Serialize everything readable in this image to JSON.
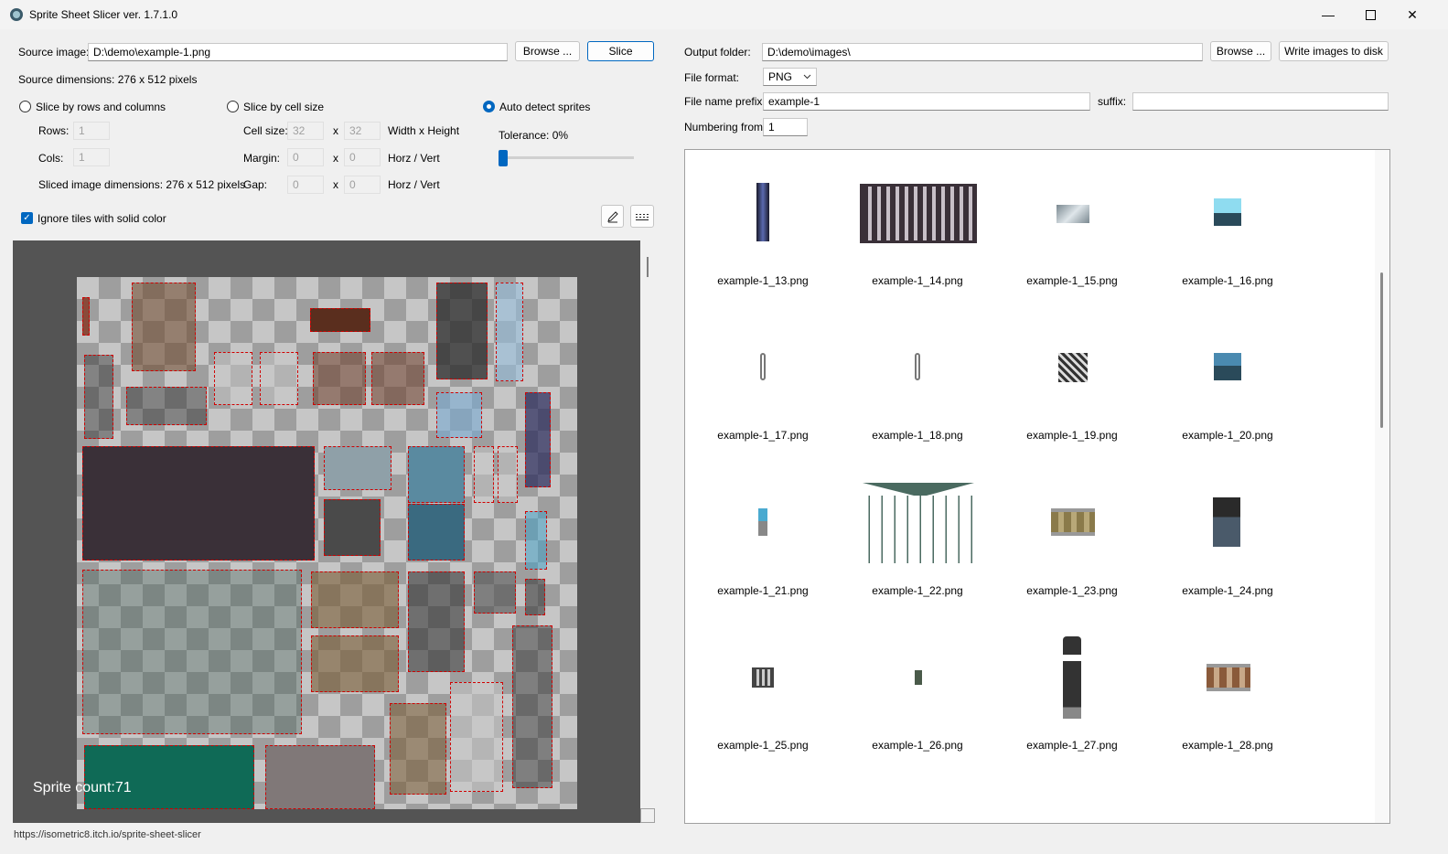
{
  "window": {
    "title": "Sprite Sheet Slicer ver. 1.7.1.0"
  },
  "source": {
    "label": "Source image:",
    "path": "D:\\demo\\example-1.png",
    "browse": "Browse ...",
    "slice": "Slice",
    "dimensions": "Source dimensions:   276 x 512 pixels"
  },
  "modes": {
    "rows_cols": "Slice by rows and columns",
    "cell_size": "Slice by cell size",
    "auto": "Auto detect sprites",
    "selected": "Auto detect sprites"
  },
  "rows_cols": {
    "rows_label": "Rows:",
    "rows": "1",
    "cols_label": "Cols:",
    "cols": "1",
    "sliced_dims": "Sliced image dimensions:   276 x 512 pixels"
  },
  "cell": {
    "cell_label": "Cell size:",
    "cell_w": "32",
    "cell_h": "32",
    "cell_unit": "Width x Height",
    "margin_label": "Margin:",
    "margin_h": "0",
    "margin_v": "0",
    "margin_unit": "Horz / Vert",
    "gap_label": "Gap:",
    "gap_h": "0",
    "gap_v": "0",
    "gap_unit": "Horz / Vert",
    "x": "x"
  },
  "auto": {
    "tolerance_label": "Tolerance:   0%",
    "tolerance": 0
  },
  "ignore_solid": {
    "label": "Ignore tiles with solid color",
    "checked": true
  },
  "preview": {
    "sprite_count": "Sprite count:71"
  },
  "output": {
    "folder_label": "Output folder:",
    "folder": "D:\\demo\\images\\",
    "browse": "Browse ...",
    "write": "Write images to disk",
    "format_label": "File format:",
    "format": "PNG",
    "prefix_label": "File name prefix:",
    "prefix": "example-1",
    "suffix_label": "suffix:",
    "suffix": "",
    "numbering_label": "Numbering from:",
    "numbering": "1"
  },
  "files": [
    {
      "name": "example-1_13.png",
      "icon": "pipe-vertical-icon"
    },
    {
      "name": "example-1_14.png",
      "icon": "fence-icon"
    },
    {
      "name": "example-1_15.png",
      "icon": "glass-panel-icon"
    },
    {
      "name": "example-1_16.png",
      "icon": "computer-icon"
    },
    {
      "name": "example-1_17.png",
      "icon": "chain-icon"
    },
    {
      "name": "example-1_18.png",
      "icon": "chain-icon"
    },
    {
      "name": "example-1_19.png",
      "icon": "grate-icon"
    },
    {
      "name": "example-1_20.png",
      "icon": "computer-icon"
    },
    {
      "name": "example-1_21.png",
      "icon": "sign-post-icon"
    },
    {
      "name": "example-1_22.png",
      "icon": "t-pipe-icon"
    },
    {
      "name": "example-1_23.png",
      "icon": "rail-track-icon"
    },
    {
      "name": "example-1_24.png",
      "icon": "machine-icon"
    },
    {
      "name": "example-1_25.png",
      "icon": "grill-icon"
    },
    {
      "name": "example-1_26.png",
      "icon": "switch-box-icon"
    },
    {
      "name": "example-1_27.png",
      "icon": "lamp-post-icon"
    },
    {
      "name": "example-1_28.png",
      "icon": "rail-track-icon"
    }
  ],
  "status": {
    "url": "https://isometric8.itch.io/sprite-sheet-slicer"
  },
  "colors": {
    "accent": "#0067c0",
    "preview_bg": "#545454",
    "slice_outline": "#d00000"
  }
}
